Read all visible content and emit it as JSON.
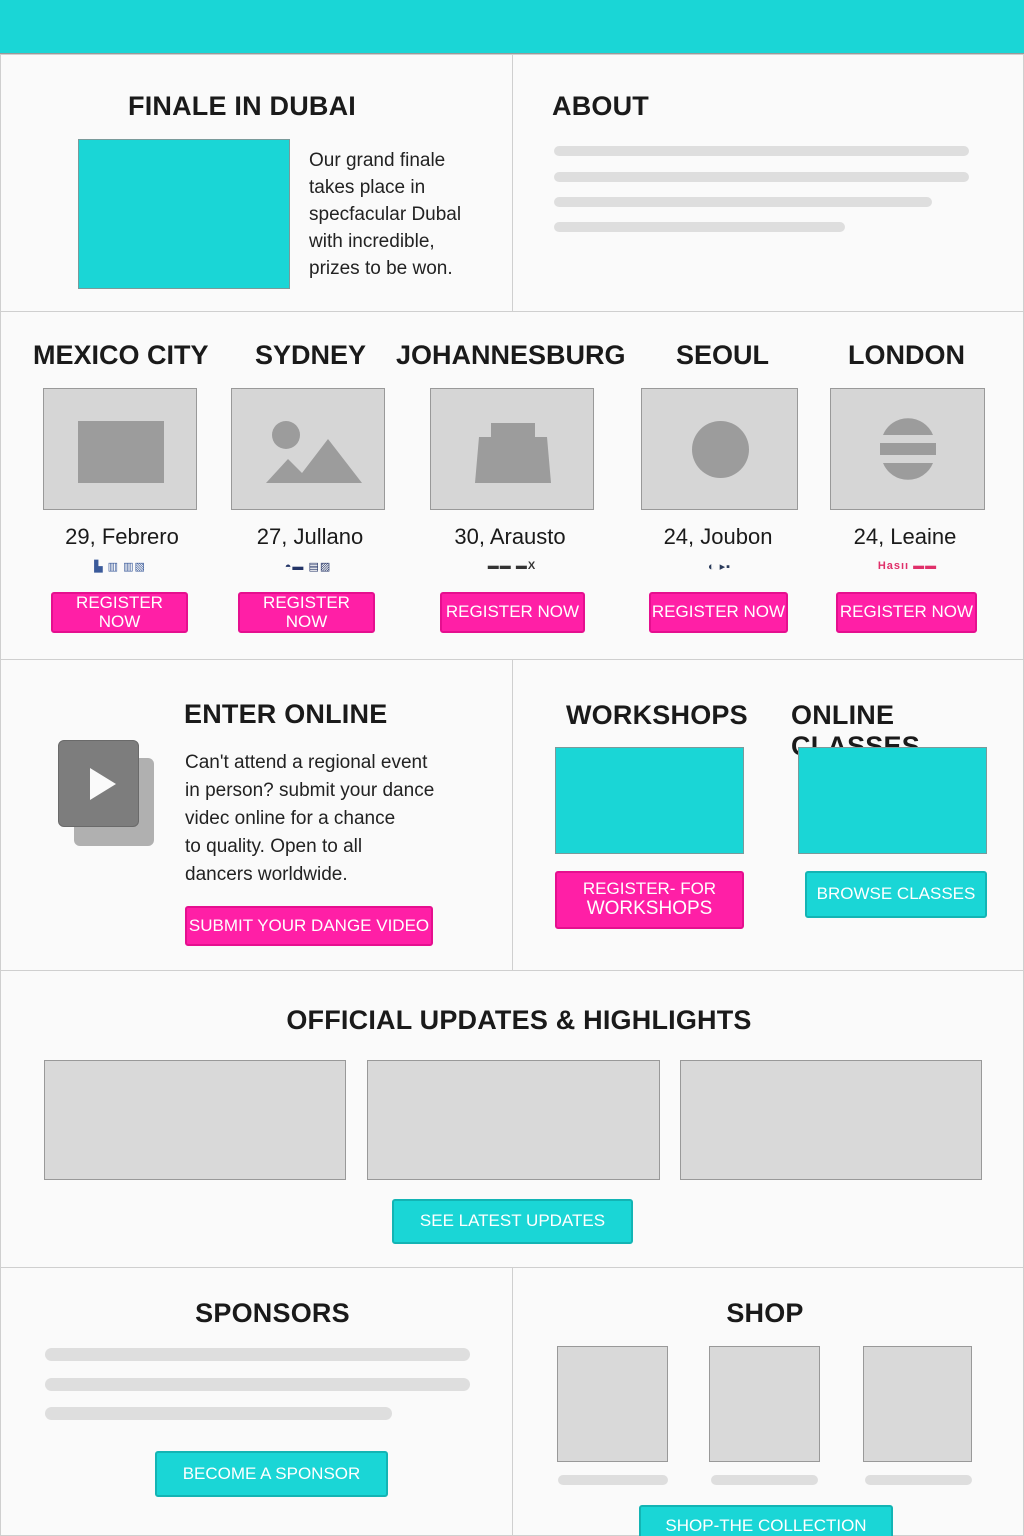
{
  "finale": {
    "title": "FINALE IN DUBAI",
    "text_lines": [
      "Our grand finale",
      "takes place in",
      "specfacular Dubal",
      "with incredible,",
      "prizes to be won."
    ]
  },
  "about": {
    "title": "ABOUT"
  },
  "cities": [
    {
      "name": "MEXICO CITY",
      "date": "29, Febrero",
      "flags": "▙ ▥ ▥▧",
      "button": "REGISTER NOW",
      "icon": "rectangle-icon"
    },
    {
      "name": "SYDNEY",
      "date": "27, Jullano",
      "flags": "◓▬ ▤▨",
      "button": "REGISTER NOW",
      "icon": "image-icon"
    },
    {
      "name": "JOHANNESBURG",
      "date": "30, Arausto",
      "flags": "▬▬ ▬X",
      "button": "REGISTER NOW",
      "icon": "building-icon"
    },
    {
      "name": "SEOUL",
      "date": "24, Joubon",
      "flags": "◐ ▸▪",
      "button": "REGISTER NOW",
      "icon": "circle-icon"
    },
    {
      "name": "LONDON",
      "date": "24, Leaine",
      "flags": "Hasıı ▬▬",
      "button": "REGISTER NOW",
      "icon": "globe-icon"
    }
  ],
  "enter_online": {
    "title": "ENTER ONLINE",
    "text_lines": [
      "Can't attend a regional event",
      "in person? submit your dance",
      "videc online for a chance",
      "to quality. Open to all",
      "dancers worldwide."
    ],
    "button": "SUBMIT YOUR DANGE VIDEO"
  },
  "workshops": {
    "title": "WORKSHOPS",
    "button_line1": "REGISTER- FOR",
    "button_line2": "WORKSHOPS"
  },
  "online_classes": {
    "title": "ONLINE CLASSES",
    "button": "BROWSE CLASSES"
  },
  "updates": {
    "title": "OFFICIAL UPDATES & HIGHLIGHTS",
    "button": "SEE LATEST UPDATES"
  },
  "sponsors": {
    "title": "SPONSORS",
    "button": "BECOME A SPONSOR"
  },
  "shop": {
    "title": "SHOP",
    "button": "SHOP-THE COLLECTION"
  },
  "colors": {
    "accent_teal": "#1ad6d6",
    "accent_pink": "#ff1fa6",
    "placeholder_grey": "#d9d9d9"
  }
}
